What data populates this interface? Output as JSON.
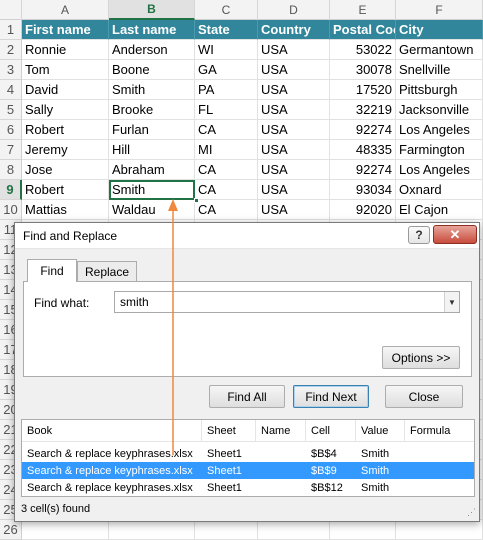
{
  "spreadsheet": {
    "columns": [
      "A",
      "B",
      "C",
      "D",
      "E",
      "F"
    ],
    "active_column": "B",
    "row_numbers": [
      "1",
      "2",
      "3",
      "4",
      "5",
      "6",
      "7",
      "8",
      "9",
      "10",
      "11",
      "12",
      "13",
      "14",
      "15",
      "16",
      "17",
      "18",
      "19",
      "20",
      "21",
      "22",
      "23",
      "24",
      "25",
      "26"
    ],
    "active_row": "9",
    "header": [
      "First name",
      "Last name",
      "State",
      "Country",
      "Postal Coc",
      "City"
    ],
    "rows": [
      [
        "Ronnie",
        "Anderson",
        "WI",
        "USA",
        "53022",
        "Germantown"
      ],
      [
        "Tom",
        "Boone",
        "GA",
        "USA",
        "30078",
        "Snellville"
      ],
      [
        "David",
        "Smith",
        "PA",
        "USA",
        "17520",
        "Pittsburgh"
      ],
      [
        "Sally",
        "Brooke",
        "FL",
        "USA",
        "32219",
        "Jacksonville"
      ],
      [
        "Robert",
        "Furlan",
        "CA",
        "USA",
        "92274",
        "Los Angeles"
      ],
      [
        "Jeremy",
        "Hill",
        "MI",
        "USA",
        "48335",
        "Farmington"
      ],
      [
        "Jose",
        "Abraham",
        "CA",
        "USA",
        "92274",
        "Los Angeles"
      ],
      [
        "Robert",
        "Smith",
        "CA",
        "USA",
        "93034",
        "Oxnard"
      ],
      [
        "Mattias",
        "Waldau",
        "CA",
        "USA",
        "92020",
        "El Cajon"
      ]
    ],
    "selected_cell": "B9"
  },
  "dialog": {
    "title": "Find and Replace",
    "help_label": "?",
    "close_label": "✕",
    "tabs": [
      {
        "label": "Find",
        "active": true
      },
      {
        "label": "Replace",
        "active": false
      }
    ],
    "find_what_label": "Find what:",
    "find_what_value": "smith",
    "dropdown_icon": "chevron-down-icon",
    "options_label": "Options >>",
    "find_all_label": "Find All",
    "find_next_label": "Find Next",
    "close_button_label": "Close",
    "results": {
      "columns": [
        "Book",
        "Sheet",
        "Name",
        "Cell",
        "Value",
        "Formula"
      ],
      "rows": [
        {
          "book": "Search & replace keyphrases.xlsx",
          "sheet": "Sheet1",
          "name": "",
          "cell": "$B$4",
          "value": "Smith",
          "formula": "",
          "selected": false
        },
        {
          "book": "Search & replace keyphrases.xlsx",
          "sheet": "Sheet1",
          "name": "",
          "cell": "$B$9",
          "value": "Smith",
          "formula": "",
          "selected": true
        },
        {
          "book": "Search & replace keyphrases.xlsx",
          "sheet": "Sheet1",
          "name": "",
          "cell": "$B$12",
          "value": "Smith",
          "formula": "",
          "selected": false
        }
      ]
    },
    "status": "3 cell(s) found"
  },
  "colors": {
    "header_fill": "#31869b",
    "selection_green": "#217346",
    "result_highlight": "#3399ff",
    "arrow": "#f0883e"
  }
}
